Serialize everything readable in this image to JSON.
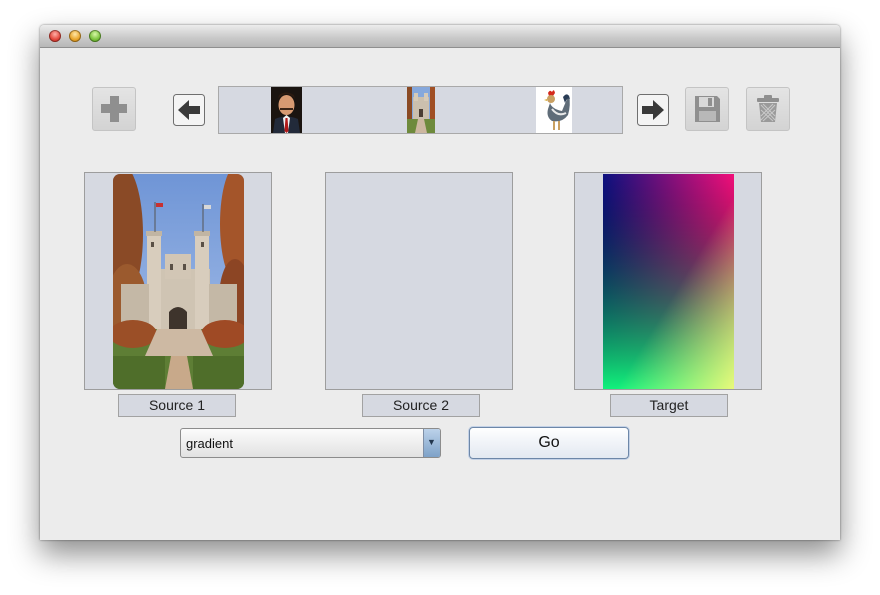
{
  "window": {
    "controls": [
      "close",
      "minimize",
      "zoom"
    ]
  },
  "toolbar": {
    "add_icon": "plus-icon",
    "prev_icon": "left-arrow-icon",
    "next_icon": "right-arrow-icon",
    "save_icon": "floppy-disk-icon",
    "delete_icon": "trash-can-icon"
  },
  "thumbnails": [
    {
      "subject": "portrait-man"
    },
    {
      "subject": "campus-building"
    },
    {
      "subject": "rooster"
    }
  ],
  "panels": {
    "source1": {
      "caption": "Source 1",
      "image": "campus-building"
    },
    "source2": {
      "caption": "Source 2",
      "image": ""
    },
    "target": {
      "caption": "Target",
      "image": "gradient"
    }
  },
  "controls": {
    "mode_select": {
      "selected": "gradient"
    },
    "go_label": "Go"
  },
  "colors": {
    "panel_bg": "#d6d9e1",
    "window_bg": "#ececec",
    "gradient_corners": [
      "#0c1180",
      "#f20f7a",
      "#11f27c",
      "#f5f97a"
    ]
  }
}
